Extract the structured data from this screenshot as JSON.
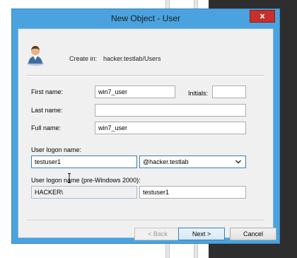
{
  "window": {
    "title": "New Object - User",
    "close_glyph": "x"
  },
  "create_in": {
    "label": "Create in:",
    "path": "hacker.testlab/Users"
  },
  "fields": {
    "first_name": {
      "label": "First name:",
      "value": "win7_user"
    },
    "initials": {
      "label": "Initials:",
      "value": ""
    },
    "last_name": {
      "label": "Last name:",
      "value": ""
    },
    "full_name": {
      "label": "Full name:",
      "value": "win7_user"
    },
    "logon_name": {
      "label": "User logon name:",
      "value": "testuser1",
      "domain": "@hacker.testlab"
    },
    "pre2000": {
      "label": "User logon name (pre-Windows 2000):",
      "domain_prefix": "HACKER\\",
      "value": "testuser1"
    }
  },
  "buttons": {
    "back": "< Back",
    "next": "Next >",
    "cancel": "Cancel"
  },
  "icons": [
    "user-icon",
    "close-icon",
    "chevron-down-icon",
    "text-cursor-icon"
  ],
  "colors": {
    "title_bar": "#4aa3df",
    "close": "#c7302b",
    "client": "#f0f0f0"
  }
}
